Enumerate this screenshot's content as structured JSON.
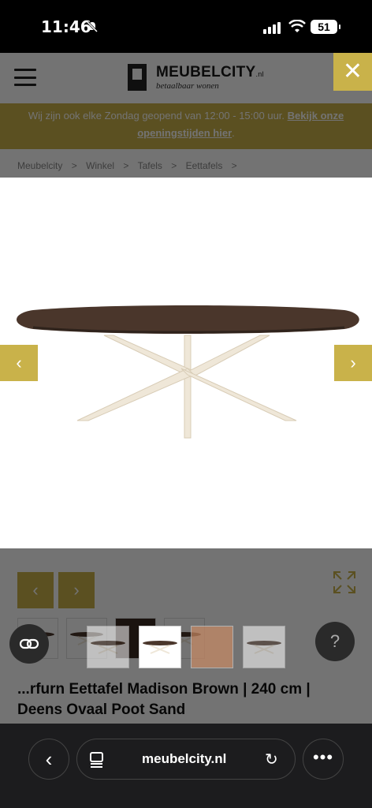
{
  "status": {
    "time": "11:46",
    "battery": "51"
  },
  "header": {
    "logo_name": "MEUBELCITY",
    "logo_suffix": ".nl",
    "logo_tagline": "betaalbaar wonen",
    "close_symbol": "✕"
  },
  "promo": {
    "text": "Wij zijn ook elke Zondag geopend van 12:00 - 15:00 uur.",
    "link": "Bekijk onze openingstijden hier",
    "end": "."
  },
  "breadcrumb": [
    "Meubelcity",
    ">",
    "Winkel",
    ">",
    "Tafels",
    ">",
    "Eettafels",
    ">"
  ],
  "product": {
    "title": "...rfurn Eettafel Madison Brown | 240 cm | Deens Ovaal Poot Sand"
  },
  "browser": {
    "url": "meubelcity.nl"
  },
  "colors": {
    "accent": "#c9b24a",
    "tabletop": "#4a362b",
    "legs": "#efe7d8"
  }
}
